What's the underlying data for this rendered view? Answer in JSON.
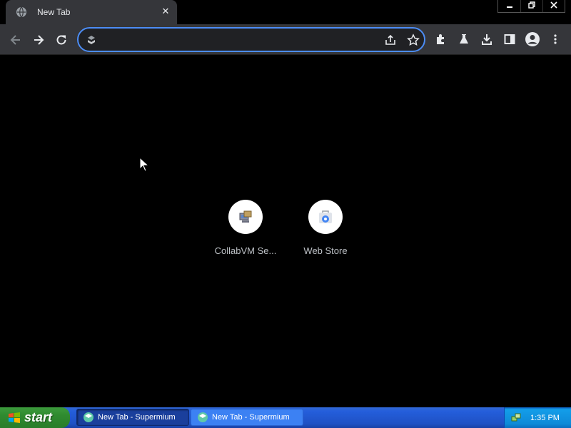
{
  "tab": {
    "title": "New Tab",
    "close_icon": "close-icon",
    "favicon": "globe-icon"
  },
  "window_controls": {
    "minimize": "minimize-icon",
    "restore": "restore-icon",
    "close": "close-icon"
  },
  "toolbar": {
    "back_icon": "arrow-left-icon",
    "forward_icon": "arrow-right-icon",
    "reload_icon": "reload-icon",
    "omnibox": {
      "value": "",
      "placeholder": ""
    },
    "share_icon": "share-icon",
    "bookmark_icon": "star-icon",
    "extensions_icon": "puzzle-icon",
    "labs_icon": "flask-icon",
    "downloads_icon": "download-icon",
    "sidepanel_icon": "side-panel-icon",
    "profile_icon": "avatar-icon",
    "menu_icon": "kebab-menu-icon"
  },
  "shortcuts": [
    {
      "label": "CollabVM Se...",
      "icon": "collabvm-icon"
    },
    {
      "label": "Web Store",
      "icon": "web-store-icon"
    }
  ],
  "taskbar": {
    "start_label": "start",
    "buttons": [
      {
        "label": "New Tab - Supermium",
        "state": "active"
      },
      {
        "label": "New Tab - Supermium",
        "state": "inactive"
      }
    ],
    "clock": "1:35 PM"
  },
  "colors": {
    "accent_focus": "#4c8df6",
    "toolbar_bg": "#35363a",
    "page_bg": "#000000",
    "taskbar_blue": "#245edb",
    "start_green": "#2f8a2f"
  }
}
